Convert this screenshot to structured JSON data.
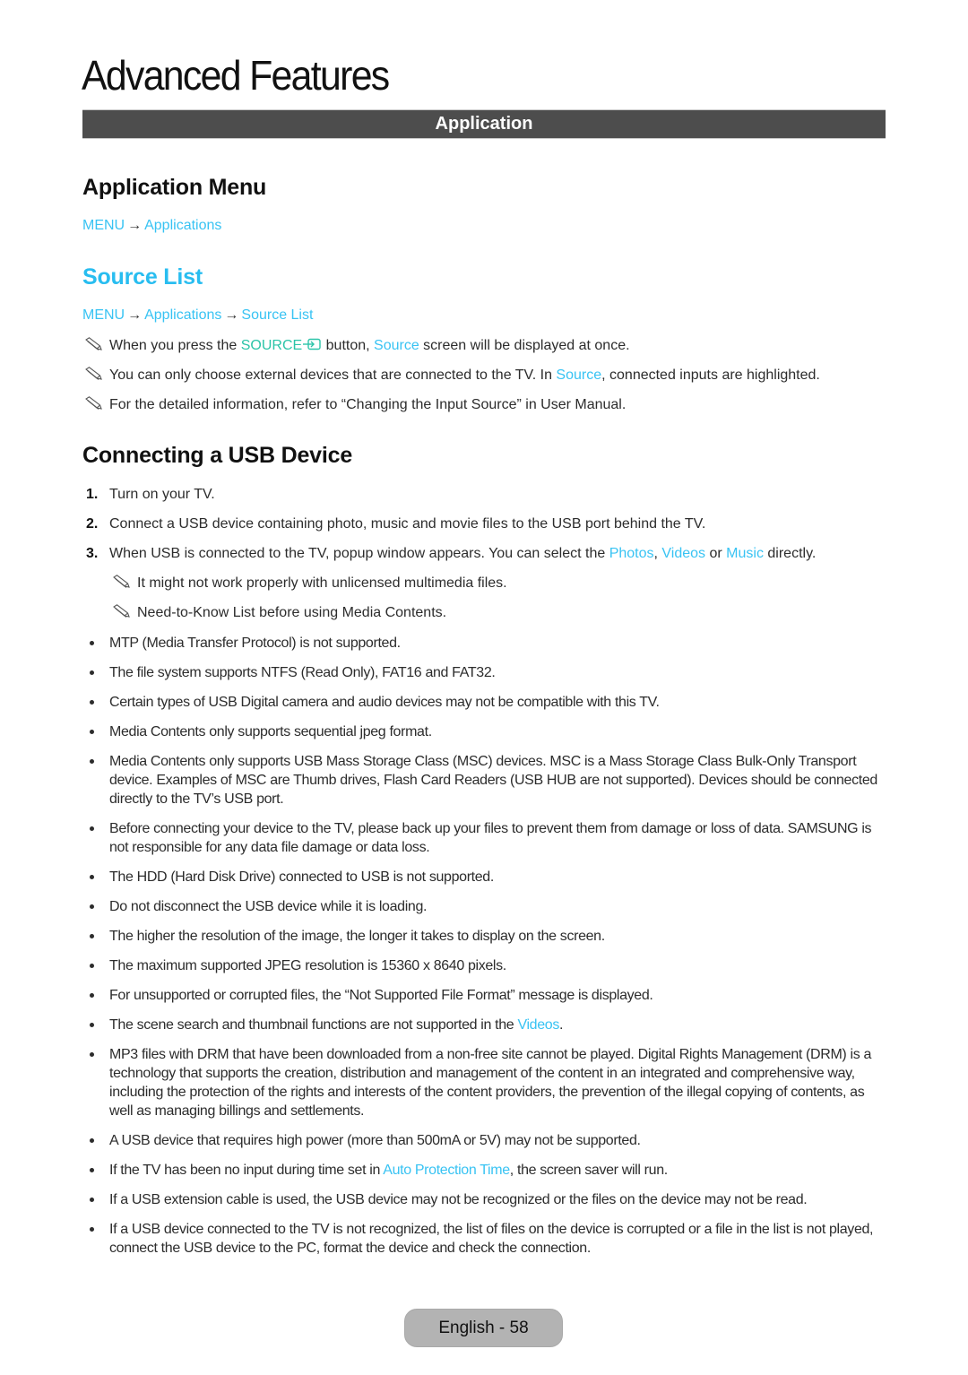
{
  "page": {
    "title": "Advanced Features",
    "section_bar": "Application",
    "footer_badge": "English - 58"
  },
  "colors": {
    "link_blue": "#38c3f3",
    "heading_blue": "#28bdf0",
    "source_button_teal": "#2bc4a8",
    "section_bar_bg": "#4d4d4d",
    "footer_badge_bg": "#b3b3b3"
  },
  "application_menu": {
    "heading": "Application Menu",
    "path": [
      "MENU",
      "Applications"
    ],
    "arrow": "→"
  },
  "source_list": {
    "heading": "Source List",
    "path": [
      "MENU",
      "Applications",
      "Source List"
    ],
    "arrow": "→",
    "notes": [
      {
        "icon": "pencil-note-icon",
        "parts": [
          "When you press the ",
          "SOURCE",
          " button, ",
          "Source",
          " screen will be displayed at once."
        ]
      },
      {
        "icon": "pencil-note-icon",
        "parts": [
          "You can only choose external devices that are connected to the TV. In ",
          "Source",
          ", connected inputs are highlighted."
        ]
      },
      {
        "icon": "pencil-note-icon",
        "text": "For the detailed information, refer to “Changing the Input Source” in User Manual."
      }
    ]
  },
  "usb": {
    "heading": "Connecting a USB Device",
    "steps": [
      {
        "num": "1.",
        "text": "Turn on your TV."
      },
      {
        "num": "2.",
        "text": "Connect a USB device containing photo, music and movie files to the USB port behind the TV."
      },
      {
        "num": "3.",
        "parts": [
          "When USB is connected to the TV, popup window appears. You can select the ",
          "Photos",
          ", ",
          "Videos",
          " or ",
          "Music",
          " directly."
        ]
      }
    ],
    "step3_notes": [
      "It might not work properly with unlicensed multimedia files.",
      "Need-to-Know List before using Media Contents."
    ],
    "bullets": [
      {
        "text": "MTP (Media Transfer Protocol) is not supported."
      },
      {
        "text": "The file system supports NTFS (Read Only), FAT16 and FAT32."
      },
      {
        "text": "Certain types of USB Digital camera and audio devices may not be compatible with this TV."
      },
      {
        "text": "Media Contents only supports sequential jpeg format."
      },
      {
        "text": "Media Contents only supports USB Mass Storage Class (MSC) devices. MSC is a Mass Storage Class Bulk-Only Transport device. Examples of MSC are Thumb drives, Flash Card Readers (USB HUB are not supported). Devices should be connected directly to the TV’s USB port."
      },
      {
        "text": "Before connecting your device to the TV, please back up your files to prevent them from damage or loss of data. SAMSUNG is not responsible for any data file damage or data loss."
      },
      {
        "text": "The HDD (Hard Disk Drive) connected to USB is not supported."
      },
      {
        "text": "Do not disconnect the USB device while it is loading."
      },
      {
        "text": "The higher the resolution of the image, the longer it takes to display on the screen."
      },
      {
        "text": "The maximum supported JPEG resolution is 15360 x 8640 pixels."
      },
      {
        "text": "For unsupported or corrupted files, the “Not Supported File Format” message is displayed."
      },
      {
        "pre": "The scene search and thumbnail functions are not supported in the ",
        "link": "Videos",
        "post": "."
      },
      {
        "text": "MP3 files with DRM that have been downloaded from a non-free site cannot be played. Digital Rights Management (DRM) is a technology that supports the creation, distribution and management of the content in an integrated and comprehensive way, including the protection of the rights and interests of the content providers, the prevention of the illegal copying of contents, as well as managing billings and settlements."
      },
      {
        "text": "A USB device that requires high power (more than 500mA or 5V) may not be supported."
      },
      {
        "pre": "If the TV has been no input during time set in ",
        "link": "Auto Protection Time",
        "post": ", the screen saver will run."
      },
      {
        "text": "If a USB extension cable is used, the USB device may not be recognized or the files on the device may not be read."
      },
      {
        "text": "If a USB device connected to the TV is not recognized, the list of files on the device is corrupted or a file in the list is not played, connect the USB device to the PC, format the device and check the connection."
      }
    ]
  }
}
